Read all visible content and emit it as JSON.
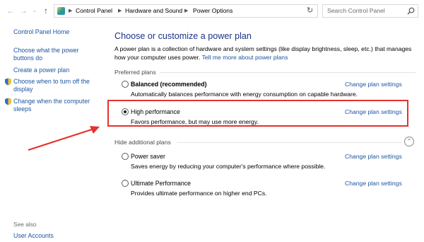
{
  "address_bar": {
    "breadcrumbs": [
      "Control Panel",
      "Hardware and Sound",
      "Power Options"
    ],
    "search_placeholder": "Search Control Panel"
  },
  "sidebar": {
    "home": "Control Panel Home",
    "links": [
      "Choose what the power buttons do",
      "Create a power plan",
      "Choose when to turn off the display",
      "Change when the computer sleeps"
    ],
    "see_also": "See also",
    "user_accounts": "User Accounts"
  },
  "main": {
    "title": "Choose or customize a power plan",
    "description": "A power plan is a collection of hardware and system settings (like display brightness, sleep, etc.) that manages how your computer uses power.",
    "learn_more": "Tell me more about power plans",
    "preferred_label": "Preferred plans",
    "hidden_label": "Hide additional plans",
    "plans": [
      {
        "name": "Balanced (recommended)",
        "desc": "Automatically balances performance with energy consumption on capable hardware.",
        "selected": false,
        "change": "Change plan settings"
      },
      {
        "name": "High performance",
        "desc": "Favors performance, but may use more energy.",
        "selected": true,
        "change": "Change plan settings"
      },
      {
        "name": "Power saver",
        "desc": "Saves energy by reducing your computer's performance where possible.",
        "selected": false,
        "change": "Change plan settings"
      },
      {
        "name": "Ultimate Performance",
        "desc": "Provides ultimate performance on higher end PCs.",
        "selected": false,
        "change": "Change plan settings"
      }
    ]
  },
  "colors": {
    "accent_link": "#1e55a0",
    "title": "#1e3287",
    "annotation": "#e5312d"
  }
}
